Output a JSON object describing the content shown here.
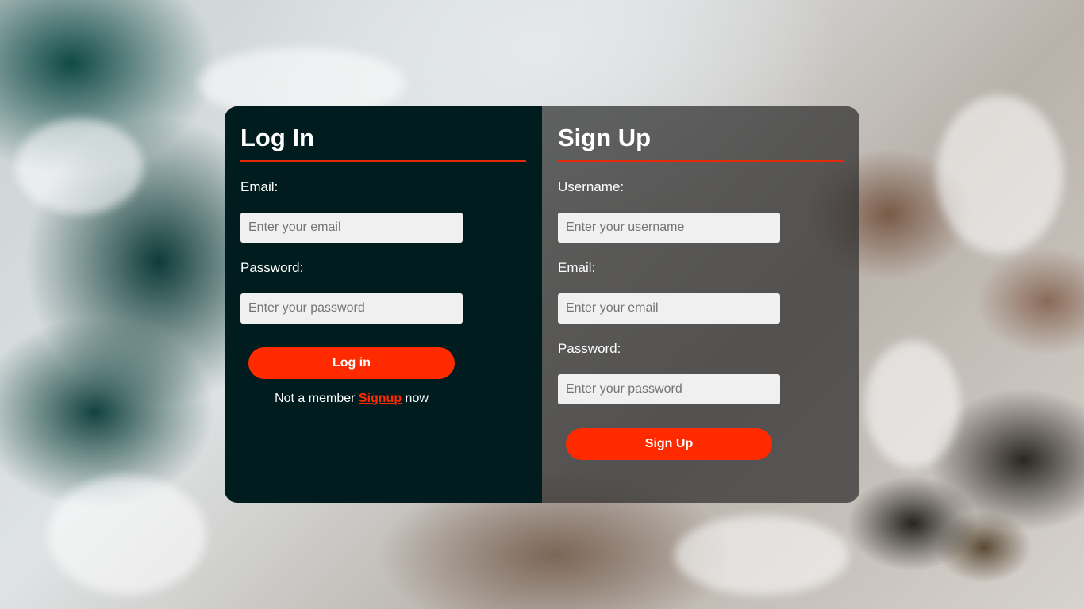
{
  "login": {
    "title": "Log In",
    "email_label": "Email:",
    "email_placeholder": "Enter your email",
    "password_label": "Password:",
    "password_placeholder": "Enter your password",
    "button_label": "Log in",
    "member_prefix": "Not a member ",
    "member_link": "Signup",
    "member_suffix": " now"
  },
  "signup": {
    "title": "Sign Up",
    "username_label": "Username:",
    "username_placeholder": "Enter your username",
    "email_label": "Email:",
    "email_placeholder": "Enter your email",
    "password_label": "Password:",
    "password_placeholder": "Enter your password",
    "button_label": "Sign Up"
  },
  "colors": {
    "accent": "#ff2a00",
    "login_panel": "#001c1f",
    "signup_panel": "#2d2d2d",
    "input_bg": "#f0f0f0"
  }
}
